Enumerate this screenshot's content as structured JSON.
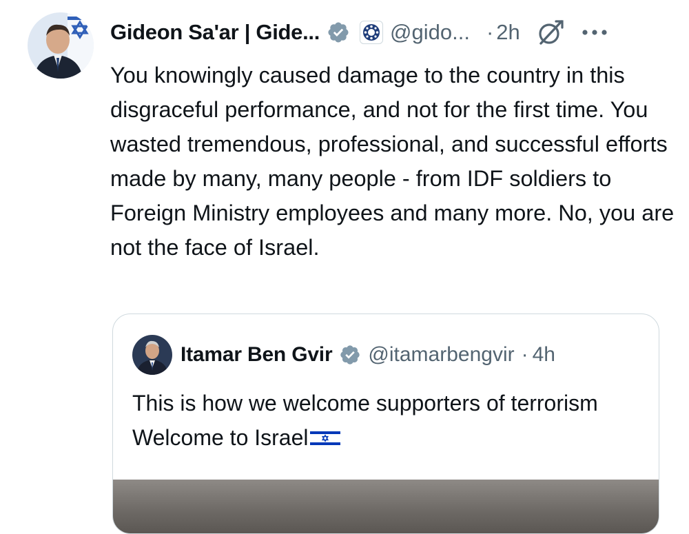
{
  "tweet": {
    "display_name": "Gideon Sa'ar | Gide...",
    "handle": "@gido...",
    "separator": "·",
    "time": "2h",
    "body": "You knowingly caused damage to the country in this disgraceful performance, and not for the first time. You wasted tremendous, professional, and successful efforts made by many, many people - from IDF soldiers to Foreign Ministry employees and many more. No, you are not the face of Israel."
  },
  "quoted": {
    "display_name": "Itamar Ben Gvir",
    "handle": "@itamarbengvir",
    "separator": "·",
    "time": "4h",
    "body": "This is how we welcome supporters of terrorism Welcome to Israel"
  },
  "colors": {
    "text": "#0f1419",
    "secondary": "#536471",
    "verified_badge": "#829aab",
    "border": "#cfd9de",
    "flag_blue": "#0038b8"
  },
  "icons": [
    "verified-badge-icon",
    "affiliation-badge-icon",
    "grok-icon",
    "more-options-icon",
    "israel-flag-emoji"
  ]
}
